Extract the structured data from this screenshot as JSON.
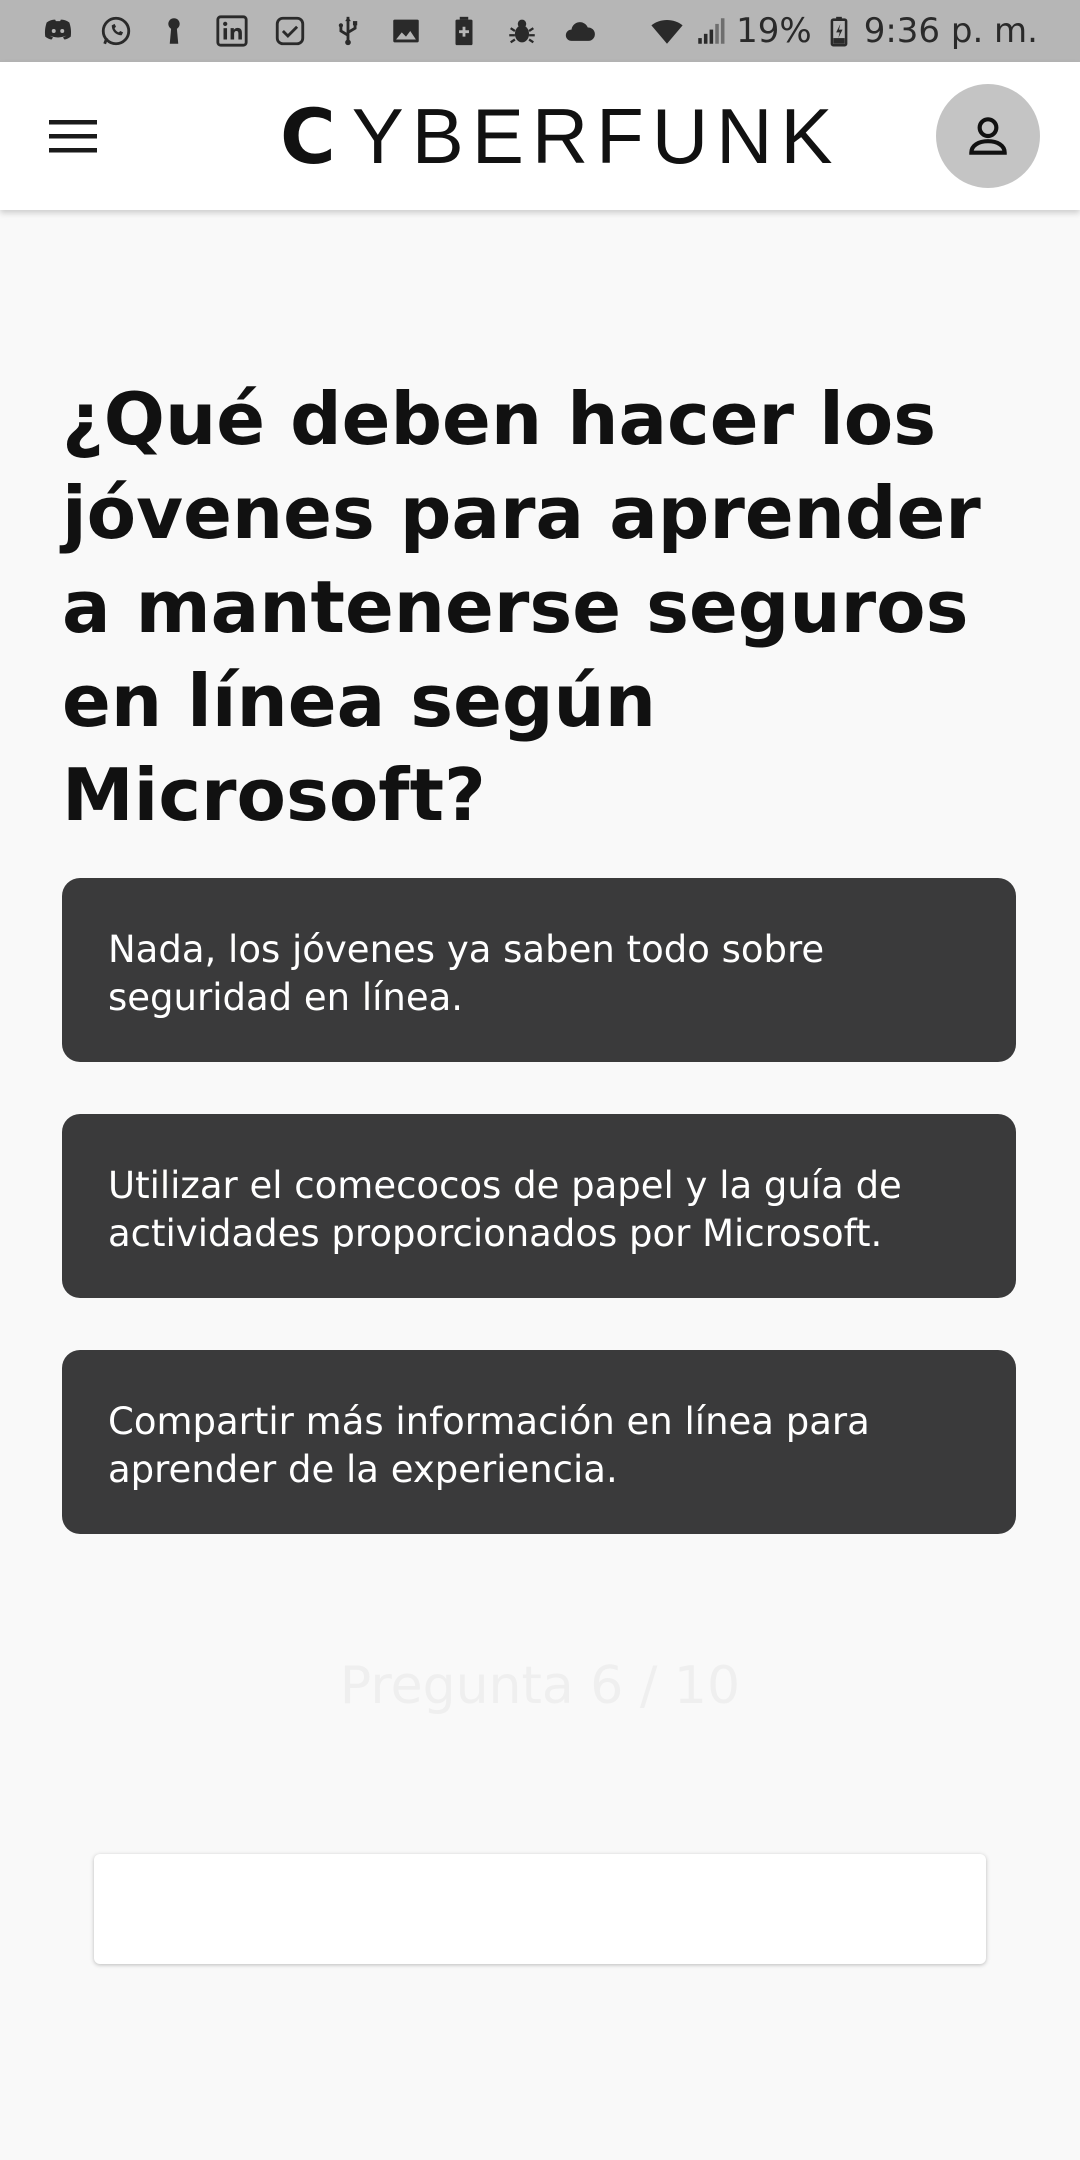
{
  "status_bar": {
    "left_icons": [
      "discord-icon",
      "whatsapp-icon",
      "keyhole-icon",
      "linkedin-icon",
      "checkbox-icon",
      "usb-icon",
      "image-icon",
      "battery-saver-icon",
      "bug-icon",
      "cloud-icon"
    ],
    "battery_percent": "19%",
    "time": "9:36 p. m."
  },
  "app_bar": {
    "logo_first": "C",
    "logo_rest": "YBERFUNK",
    "menu_icon": "hamburger-menu-icon",
    "avatar_icon": "person-icon"
  },
  "quiz": {
    "question": "¿Qué deben hacer los jóvenes para aprender a mantenerse seguros en línea según Microsoft?",
    "answers": [
      "Nada, los jóvenes ya saben todo sobre seguridad en línea.",
      "Utilizar el comecocos de papel y la guía de actividades proporcionados por Microsoft.",
      "Compartir más información en línea para aprender de la experiencia."
    ],
    "progress": "Pregunta 6 / 10"
  },
  "colors": {
    "status_bar_bg": "#b6b6b6",
    "answer_bg": "#3a3a3b",
    "page_bg": "#f9f9f9",
    "avatar_bg": "#c4c4c4"
  }
}
